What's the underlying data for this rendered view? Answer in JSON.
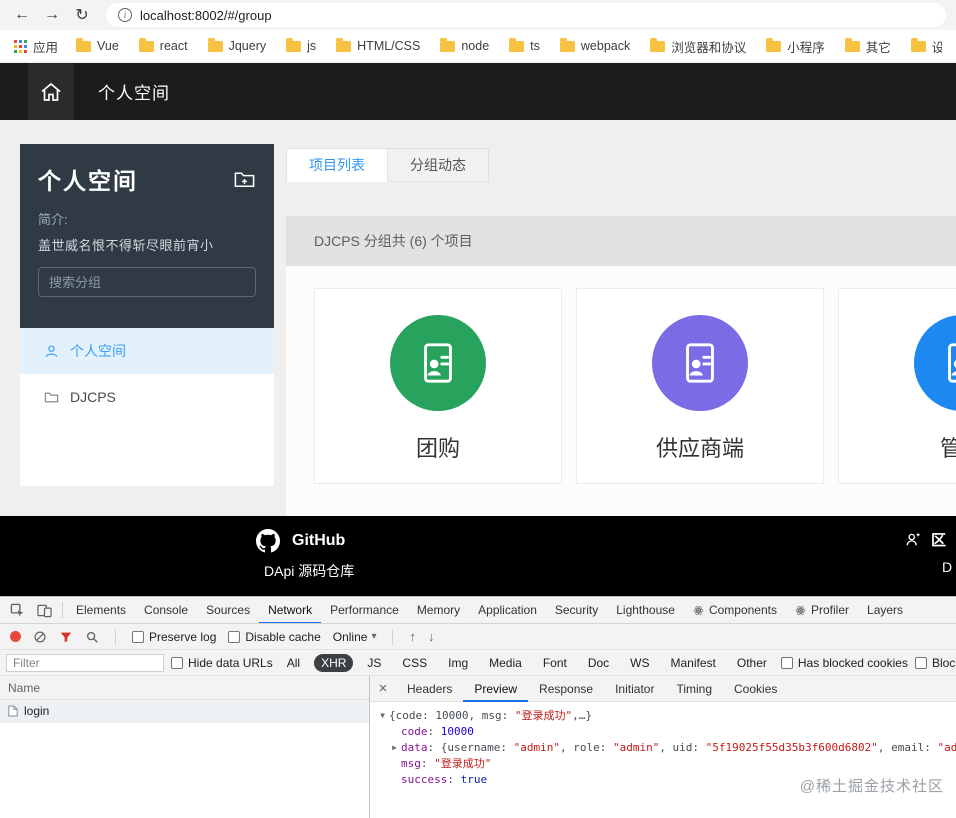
{
  "icons": {
    "back": "←",
    "forward": "→",
    "refresh": "↻",
    "info": "i",
    "caret": "▾",
    "up": "↑",
    "down": "↓",
    "close": "×",
    "tree_down": "▼",
    "tree_right": "▶"
  },
  "browser": {
    "url": "localhost:8002/#/group",
    "apps_label": "应用",
    "bookmarks": [
      "Vue",
      "react",
      "Jquery",
      "js",
      "HTML/CSS",
      "node",
      "ts",
      "webpack",
      "浏览器和协议",
      "小程序",
      "其它",
      "设计"
    ]
  },
  "navbar": {
    "title": "个人空间"
  },
  "sidebar": {
    "title": "个人空间",
    "intro_label": "简介:",
    "intro_text": "盖世威名恨不得斩尽眼前宵小",
    "search_placeholder": "搜索分组",
    "items": [
      {
        "label": "个人空间"
      },
      {
        "label": "DJCPS"
      }
    ]
  },
  "content": {
    "tabs": [
      {
        "label": "项目列表"
      },
      {
        "label": "分组动态"
      }
    ],
    "summary": "DJCPS 分组共 (6) 个项目",
    "projects": [
      {
        "name": "团购",
        "color": "#28a35d"
      },
      {
        "name": "供应商端",
        "color": "#7a6ce4"
      },
      {
        "name": "管理",
        "color": "#1e88f2"
      }
    ]
  },
  "footer": {
    "github": "GitHub",
    "repo": "DApi 源码仓库",
    "partial_top": "区",
    "partial_bottom": "D"
  },
  "devtools": {
    "tabs": [
      "Elements",
      "Console",
      "Sources",
      "Network",
      "Performance",
      "Memory",
      "Application",
      "Security",
      "Lighthouse",
      "Components",
      "Profiler",
      "Layers"
    ],
    "preserve_log": "Preserve log",
    "disable_cache": "Disable cache",
    "throttling": "Online",
    "filter_placeholder": "Filter",
    "hide_data_urls": "Hide data URLs",
    "filters": [
      "All",
      "XHR",
      "JS",
      "CSS",
      "Img",
      "Media",
      "Font",
      "Doc",
      "WS",
      "Manifest",
      "Other"
    ],
    "has_blocked_cookies": "Has blocked cookies",
    "blocked_requests": "Blocked Requests",
    "name_header": "Name",
    "requests": [
      {
        "name": "login"
      }
    ],
    "detail_tabs": [
      "Headers",
      "Preview",
      "Response",
      "Initiator",
      "Timing",
      "Cookies"
    ],
    "preview": {
      "lines": [
        {
          "arrow": "down",
          "indent": 0,
          "segments": [
            {
              "c": "plain",
              "t": "{code: "
            },
            {
              "c": "plain",
              "t": "10000"
            },
            {
              "c": "plain",
              "t": ", msg: "
            },
            {
              "c": "str",
              "t": "\"登录成功\""
            },
            {
              "c": "plain",
              "t": ",…}"
            }
          ]
        },
        {
          "arrow": "none",
          "indent": 1,
          "segments": [
            {
              "c": "key",
              "t": "code"
            },
            {
              "c": "plain",
              "t": ": "
            },
            {
              "c": "num",
              "t": "10000"
            }
          ]
        },
        {
          "arrow": "right",
          "indent": 1,
          "segments": [
            {
              "c": "key",
              "t": "data"
            },
            {
              "c": "plain",
              "t": ": "
            },
            {
              "c": "plain",
              "t": "{username: "
            },
            {
              "c": "str",
              "t": "\"admin\""
            },
            {
              "c": "plain",
              "t": ", role: "
            },
            {
              "c": "str",
              "t": "\"admin\""
            },
            {
              "c": "plain",
              "t": ", uid: "
            },
            {
              "c": "str",
              "t": "\"5f19025f55d35b3f600d6802\""
            },
            {
              "c": "plain",
              "t": ", email: "
            },
            {
              "c": "str",
              "t": "\"ad"
            }
          ]
        },
        {
          "arrow": "none",
          "indent": 1,
          "segments": [
            {
              "c": "key",
              "t": "msg"
            },
            {
              "c": "plain",
              "t": ": "
            },
            {
              "c": "str",
              "t": "\"登录成功\""
            }
          ]
        },
        {
          "arrow": "none",
          "indent": 1,
          "segments": [
            {
              "c": "key",
              "t": "success"
            },
            {
              "c": "plain",
              "t": ": "
            },
            {
              "c": "bool",
              "t": "true"
            }
          ]
        }
      ]
    },
    "watermark": "@稀土掘金技术社区"
  }
}
